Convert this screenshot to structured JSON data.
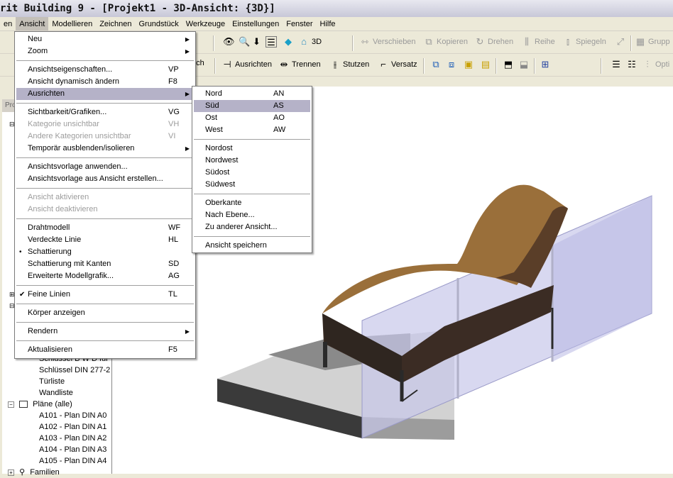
{
  "window": {
    "title": "rit Building 9 - [Projekt1 - 3D-Ansicht: {3D}]"
  },
  "menubar": [
    "en",
    "Ansicht",
    "Modellieren",
    "Zeichnen",
    "Grundstück",
    "Werkzeuge",
    "Einstellungen",
    "Fenster",
    "Hilfe"
  ],
  "toolbar1": {
    "view_label": "3D",
    "verschieben": "Verschieben",
    "kopieren": "Kopieren",
    "drehen": "Drehen",
    "reihe": "Reihe",
    "spiegeln": "Spiegeln",
    "gruppe": "Grupp"
  },
  "toolbar2": {
    "uch": "uch",
    "ausrichten": "Ausrichten",
    "trennen": "Trennen",
    "stutzen": "Stutzen",
    "versatz": "Versatz",
    "opti": "Opti"
  },
  "side_header": "Pro",
  "tree": {
    "items": [
      "Schlüssel B W D für",
      "Schlüssel DIN 277-2",
      "Türliste",
      "Wandliste",
      "Pläne (alle)",
      "A101 - Plan DIN A0",
      "A102 - Plan DIN A1",
      "A103 - Plan DIN A2",
      "A104 - Plan DIN A3",
      "A105 - Plan DIN A4",
      "Familien"
    ]
  },
  "ansicht_menu": {
    "items": [
      {
        "label": "Neu",
        "shortcut": "",
        "sub": true
      },
      {
        "label": "Zoom",
        "shortcut": "",
        "sub": true
      },
      {
        "label": "Ansichtseigenschaften...",
        "shortcut": "VP"
      },
      {
        "label": "Ansicht dynamisch ändern",
        "shortcut": "F8"
      },
      {
        "label": "Ausrichten",
        "shortcut": "",
        "sub": true,
        "highlighted": true
      },
      {
        "label": "Sichtbarkeit/Grafiken...",
        "shortcut": "VG"
      },
      {
        "label": "Kategorie unsichtbar",
        "shortcut": "VH",
        "disabled": true
      },
      {
        "label": "Andere Kategorien unsichtbar",
        "shortcut": "VI",
        "disabled": true
      },
      {
        "label": "Temporär ausblenden/isolieren",
        "shortcut": "",
        "sub": true
      },
      {
        "label": "Ansichtsvorlage anwenden...",
        "shortcut": ""
      },
      {
        "label": "Ansichtsvorlage aus Ansicht erstellen...",
        "shortcut": ""
      },
      {
        "label": "Ansicht aktivieren",
        "shortcut": "",
        "disabled": true
      },
      {
        "label": "Ansicht deaktivieren",
        "shortcut": "",
        "disabled": true
      },
      {
        "label": "Drahtmodell",
        "shortcut": "WF"
      },
      {
        "label": "Verdeckte Linie",
        "shortcut": "HL"
      },
      {
        "label": "Schattierung",
        "shortcut": "",
        "mark": "•"
      },
      {
        "label": "Schattierung mit Kanten",
        "shortcut": "SD"
      },
      {
        "label": "Erweiterte Modellgrafik...",
        "shortcut": "AG"
      },
      {
        "label": "Feine Linien",
        "shortcut": "TL",
        "mark": "✔"
      },
      {
        "label": "Körper anzeigen",
        "shortcut": ""
      },
      {
        "label": "Rendern",
        "shortcut": "",
        "sub": true
      },
      {
        "label": "Aktualisieren",
        "shortcut": "F5"
      }
    ]
  },
  "ausrichten_menu": {
    "items": [
      {
        "label": "Nord",
        "shortcut": "AN"
      },
      {
        "label": "Süd",
        "shortcut": "AS",
        "highlighted": true
      },
      {
        "label": "Ost",
        "shortcut": "AO"
      },
      {
        "label": "West",
        "shortcut": "AW"
      },
      {
        "label": "Nordost",
        "shortcut": ""
      },
      {
        "label": "Nordwest",
        "shortcut": ""
      },
      {
        "label": "Südost",
        "shortcut": ""
      },
      {
        "label": "Südwest",
        "shortcut": ""
      },
      {
        "label": "Oberkante",
        "shortcut": ""
      },
      {
        "label": "Nach Ebene...",
        "shortcut": ""
      },
      {
        "label": "Zu anderer Ansicht...",
        "shortcut": ""
      },
      {
        "label": "Ansicht speichern",
        "shortcut": ""
      }
    ]
  },
  "colors": {
    "menu_highlight": "#b5b2c8",
    "chair_wood": "#9a6f3a",
    "chair_dark": "#3b2c24",
    "glass": "#c8c8ea"
  }
}
